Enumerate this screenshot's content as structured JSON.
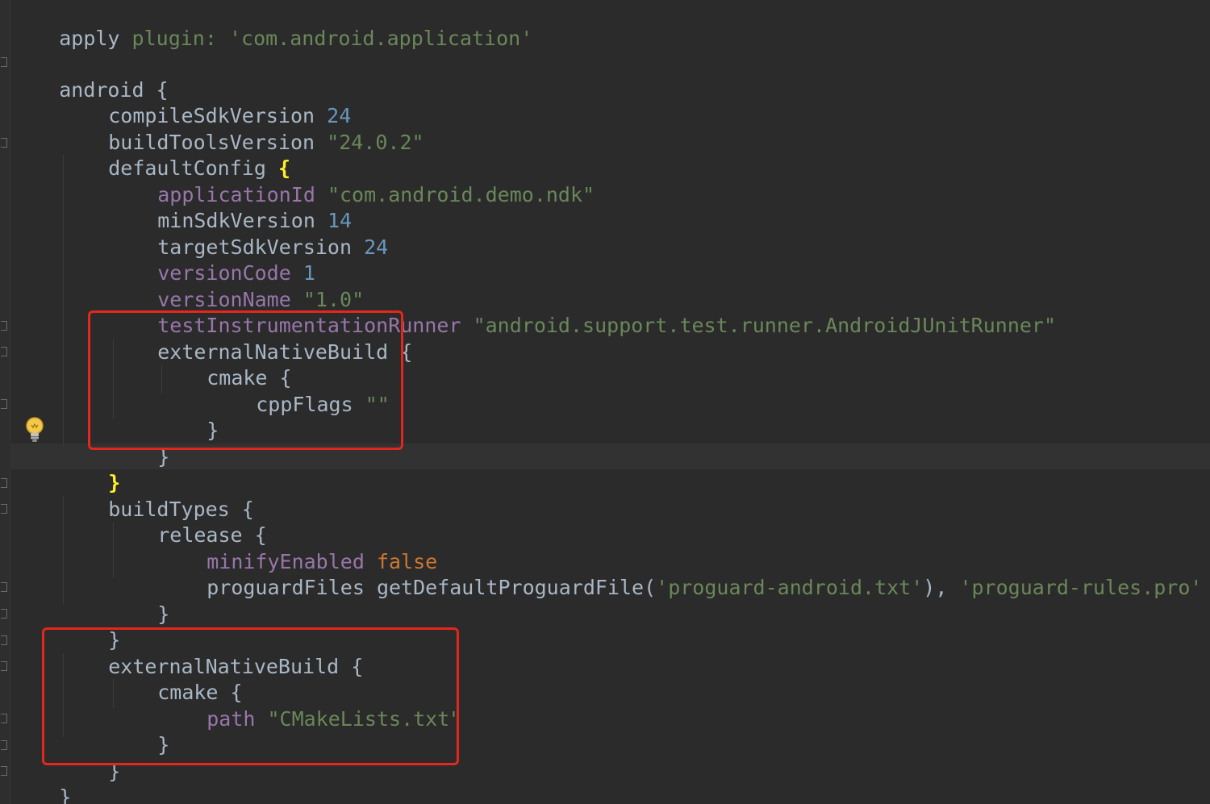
{
  "editor": {
    "lines": {
      "l01": {
        "apply": "apply",
        "plugin": "plugin:",
        "plugin_value": "'com.android.application'"
      },
      "l02": {
        "android": "android {"
      },
      "l03": {
        "key": "compileSdkVersion",
        "value": "24"
      },
      "l04": {
        "key": "buildToolsVersion",
        "value": "\"24.0.2\""
      },
      "l05": {
        "key": "defaultConfig",
        "brace": "{"
      },
      "l06": {
        "key": "applicationId",
        "value": "\"com.android.demo.ndk\""
      },
      "l07": {
        "key": "minSdkVersion",
        "value": "14"
      },
      "l08": {
        "key": "targetSdkVersion",
        "value": "24"
      },
      "l09": {
        "key": "versionCode",
        "value": "1"
      },
      "l10": {
        "key": "versionName",
        "value": "\"1.0\""
      },
      "l11": {
        "key": "testInstrumentationRunner",
        "value": "\"android.support.test.runner.AndroidJUnitRunner\""
      },
      "l12": {
        "text": "externalNativeBuild {"
      },
      "l13": {
        "text": "cmake {"
      },
      "l14": {
        "key": "cppFlags",
        "value": "\"\""
      },
      "l15": {
        "text": "}"
      },
      "l16": {
        "text": "}"
      },
      "l17": {
        "brace": "}"
      },
      "l18": {
        "text": "buildTypes {"
      },
      "l19": {
        "text": "release {"
      },
      "l20": {
        "key": "minifyEnabled",
        "value": "false"
      },
      "l21": {
        "key": "proguardFiles",
        "func": "getDefaultProguardFile(",
        "arg1": "'proguard-android.txt'",
        "sep": "), ",
        "arg2": "'proguard-rules.pro'"
      },
      "l22": {
        "text": "}"
      },
      "l23": {
        "text": "}"
      },
      "l24": {
        "text": "externalNativeBuild {"
      },
      "l25": {
        "text": "cmake {"
      },
      "l26": {
        "key": "path",
        "value": "\"CMakeLists.txt\""
      },
      "l27": {
        "text": "}"
      },
      "l28": {
        "text": "}"
      },
      "l29": {
        "text": "}"
      }
    },
    "colors": {
      "background": "#2b2b2b",
      "default_text": "#a9b7c6",
      "number": "#6897bb",
      "string": "#6a8759",
      "property": "#9876aa",
      "keyword": "#cc7832",
      "matched_brace": "#ffef28",
      "annotation_box": "#e3271c"
    },
    "icons": {
      "intention_bulb": "lightbulb-icon"
    }
  }
}
